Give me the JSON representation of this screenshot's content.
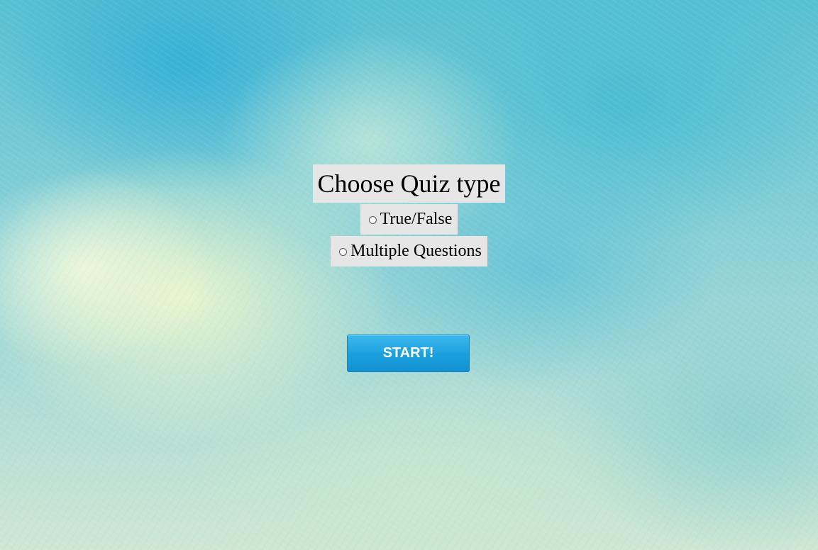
{
  "quiz": {
    "title": "Choose Quiz type",
    "options": [
      {
        "label": "True/False",
        "selected": false
      },
      {
        "label": "Multiple Questions",
        "selected": false
      }
    ],
    "start_label": "START!"
  },
  "colors": {
    "button": "#1a9fdc",
    "label_background": "#e6e6e6"
  }
}
